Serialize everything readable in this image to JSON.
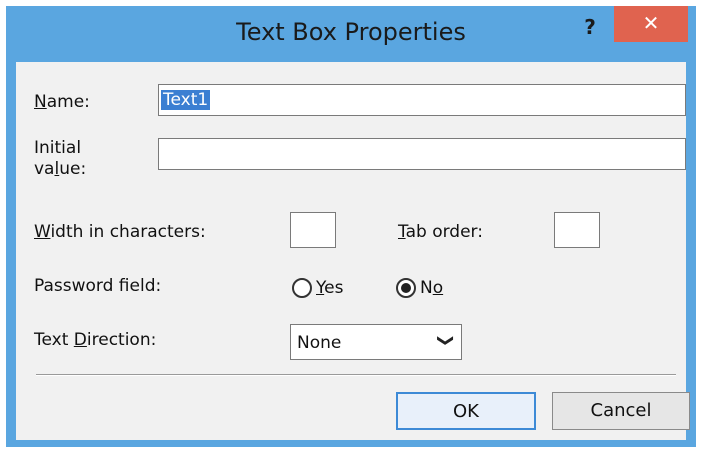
{
  "window": {
    "title": "Text Box Properties",
    "help_label": "?",
    "close_label": "✕"
  },
  "form": {
    "name": {
      "label_prefix": "",
      "label_underline": "N",
      "label_rest": "ame:",
      "value": "Text1"
    },
    "initial_value": {
      "label_line1": "Initial",
      "label_line2_prefix": "va",
      "label_line2_underline": "l",
      "label_line2_rest": "ue:",
      "value": ""
    },
    "width_in_characters": {
      "label_underline": "W",
      "label_rest": "idth in characters:",
      "value": ""
    },
    "tab_order": {
      "label_underline": "T",
      "label_rest": "ab order:",
      "value": ""
    },
    "password_field": {
      "label": "Password field:",
      "options": [
        {
          "label_underline": "Y",
          "label_rest": "es",
          "selected": false
        },
        {
          "label_prefix": "N",
          "label_underline": "o",
          "label_rest": "",
          "selected": true
        }
      ]
    },
    "text_direction": {
      "label_prefix": "Text ",
      "label_underline": "D",
      "label_rest": "irection:",
      "value": "None",
      "arrow": "❯"
    }
  },
  "buttons": {
    "ok_label": "OK",
    "cancel_label": "Cancel"
  },
  "colors": {
    "frame": "#5aa6e0",
    "close": "#e0634f",
    "selection": "#3b7fd2",
    "default_button_border": "#3d8ad6"
  }
}
